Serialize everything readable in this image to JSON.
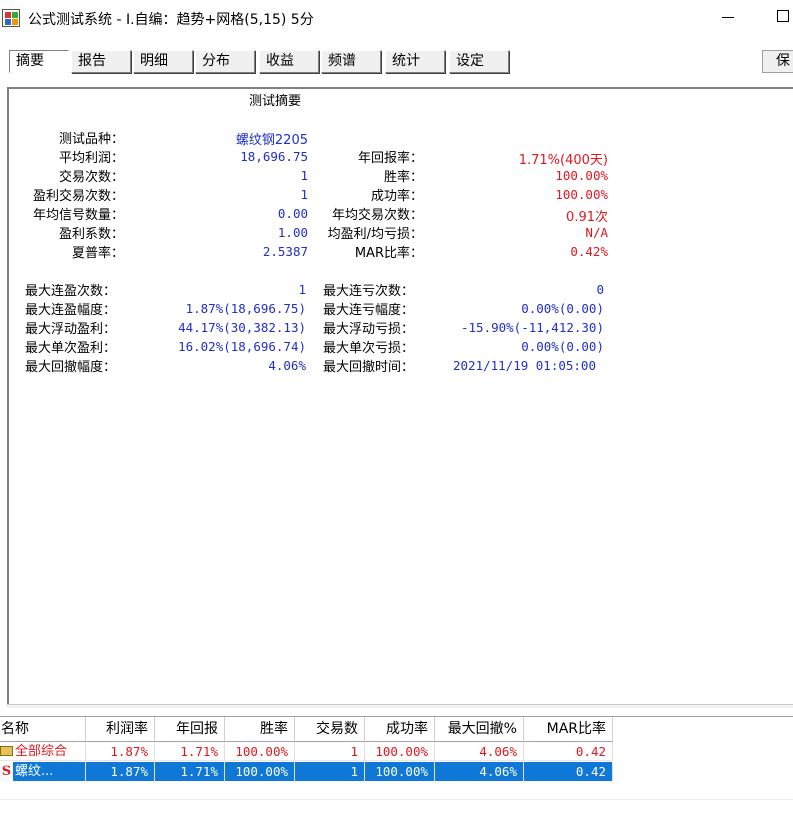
{
  "window": {
    "title": "公式测试系统 - I.自编：趋势+网格(5,15) 5分"
  },
  "tabs": [
    {
      "label": "摘要",
      "active": true
    },
    {
      "label": "报告"
    },
    {
      "label": "明细"
    },
    {
      "label": "分布"
    },
    {
      "label": "收益"
    },
    {
      "label": "频谱"
    },
    {
      "label": "统计"
    },
    {
      "label": "设定"
    }
  ],
  "save_label": "保",
  "summary": {
    "heading": "测试摘要",
    "left": [
      {
        "label": "测试品种：",
        "value": "螺纹钢2205"
      },
      {
        "label": "平均利润：",
        "value": "18,696.75"
      },
      {
        "label": "交易次数：",
        "value": "1"
      },
      {
        "label": "盈利交易次数：",
        "value": "1"
      },
      {
        "label": "年均信号数量：",
        "value": "0.00"
      },
      {
        "label": "盈利系数：",
        "value": "1.00"
      },
      {
        "label": "夏普率：",
        "value": "2.5387"
      }
    ],
    "right": [
      {
        "label": "年回报率：",
        "value": "1.71%(400天)"
      },
      {
        "label": "胜率：",
        "value": "100.00%"
      },
      {
        "label": "成功率：",
        "value": "100.00%"
      },
      {
        "label": "年均交易次数：",
        "value": "0.91次"
      },
      {
        "label": "均盈利/均亏损：",
        "value": "N/A"
      },
      {
        "label": "MAR比率：",
        "value": "0.42%"
      }
    ],
    "left2": [
      {
        "label": "最大连盈次数：",
        "value": "1"
      },
      {
        "label": "最大连盈幅度：",
        "value": "1.87%(18,696.75)"
      },
      {
        "label": "最大浮动盈利：",
        "value": "44.17%(30,382.13)"
      },
      {
        "label": "最大单次盈利：",
        "value": "16.02%(18,696.74)"
      },
      {
        "label": "最大回撤幅度：",
        "value": "4.06%"
      }
    ],
    "right2": [
      {
        "label": "最大连亏次数：",
        "value": "0"
      },
      {
        "label": "最大连亏幅度：",
        "value": "0.00%(0.00)"
      },
      {
        "label": "最大浮动亏损：",
        "value": "-15.90%(-11,412.30)"
      },
      {
        "label": "最大单次亏损：",
        "value": "0.00%(0.00)"
      },
      {
        "label": "最大回撤时间：",
        "value": "2021/11/19 01:05:00"
      }
    ]
  },
  "grid": {
    "columns": [
      "名称",
      "利润率",
      "年回报",
      "胜率",
      "交易数",
      "成功率",
      "最大回撤%",
      "MAR比率"
    ],
    "rows": [
      {
        "icon": "folder-icon",
        "cells": [
          "全部综合",
          "1.87%",
          "1.71%",
          "100.00%",
          "1",
          "100.00%",
          "4.06%",
          "0.42"
        ]
      },
      {
        "icon": "s-icon",
        "icon_text": "S",
        "selected": true,
        "cells": [
          "螺纹...",
          "1.87%",
          "1.71%",
          "100.00%",
          "1",
          "100.00%",
          "4.06%",
          "0.42"
        ]
      }
    ]
  },
  "colors": {
    "value_blue": "#1f2fcc",
    "value_red": "#e0171f",
    "selection": "#0f78d7"
  }
}
